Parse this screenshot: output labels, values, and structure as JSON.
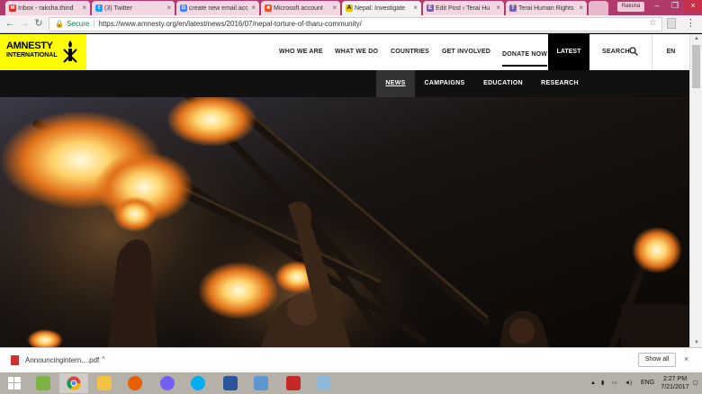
{
  "browser": {
    "tabs": [
      {
        "label": "Inbox - raksha.thind",
        "color": "#d93025",
        "fav": "M"
      },
      {
        "label": "(3) Twitter",
        "color": "#1da1f2",
        "fav": "t"
      },
      {
        "label": "create new email acc",
        "color": "#4285f4",
        "fav": "G"
      },
      {
        "label": "Microsoft account",
        "color": "#f25022",
        "fav": "■"
      },
      {
        "label": "Nepal: Investigate",
        "color": "#e6c200",
        "fav": "A"
      },
      {
        "label": "Edit Post ‹ Terai Hu",
        "color": "#7b5ea7",
        "fav": "E"
      },
      {
        "label": "Terai Human Rights",
        "color": "#7b5ea7",
        "fav": "T"
      }
    ],
    "user": "Raksha",
    "secure_label": "Secure",
    "url": "https://www.amnesty.org/en/latest/news/2016/07/nepal-torture-of-tharu-community/"
  },
  "site": {
    "logo_line1": "AMNESTY",
    "logo_line2": "INTERNATIONAL",
    "nav": {
      "who_we_are": "WHO WE ARE",
      "what_we_do": "WHAT WE DO",
      "countries": "COUNTRIES",
      "get_involved": "GET INVOLVED",
      "donate_now": "DONATE NOW",
      "latest": "LATEST",
      "search": "SEARCH",
      "language": "EN"
    },
    "subnav": {
      "news": "NEWS",
      "campaigns": "CAMPAIGNS",
      "education": "EDUCATION",
      "research": "RESEARCH"
    }
  },
  "downloads": {
    "file_name": "Announcingintern....pdf",
    "show_all": "Show all"
  },
  "taskbar": {
    "language": "ENG",
    "time": "2:27 PM",
    "date": "7/21/2017"
  }
}
